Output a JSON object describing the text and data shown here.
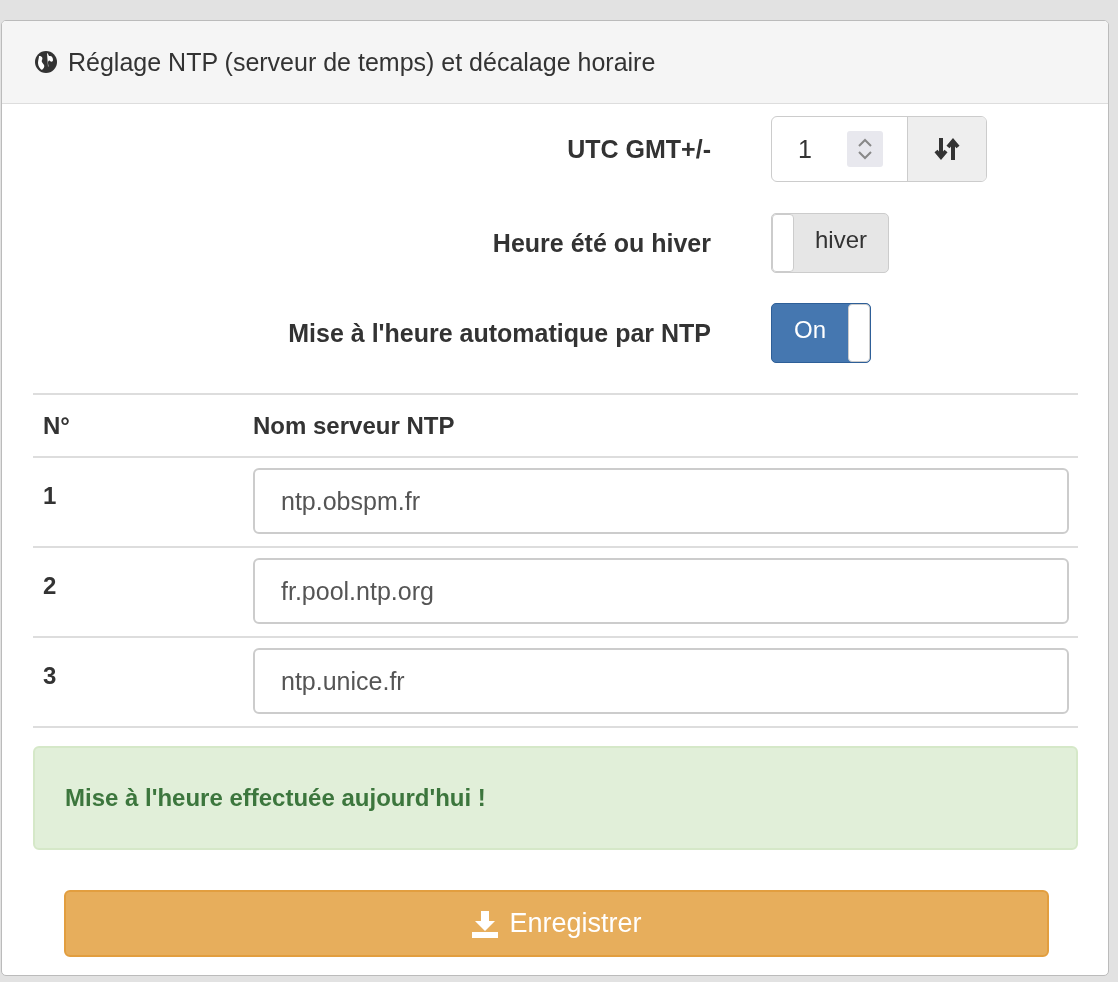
{
  "panel": {
    "title": "Réglage NTP (serveur de temps) et décalage horaire"
  },
  "utc": {
    "label": "UTC GMT+/-",
    "value": "1"
  },
  "switches": [
    {
      "label": "Heure été ou hiver",
      "text": "hiver",
      "on": false
    },
    {
      "label": "Mise à l'heure automatique par NTP",
      "text": "On",
      "on": true
    }
  ],
  "table": {
    "columns": [
      "N°",
      "Nom serveur NTP"
    ],
    "rows": [
      {
        "number": "1",
        "server": "ntp.obspm.fr"
      },
      {
        "number": "2",
        "server": "fr.pool.ntp.org"
      },
      {
        "number": "3",
        "server": "ntp.unice.fr"
      }
    ]
  },
  "alert": "Mise à l'heure effectuée aujourd'hui !",
  "save_button": "Enregistrer"
}
